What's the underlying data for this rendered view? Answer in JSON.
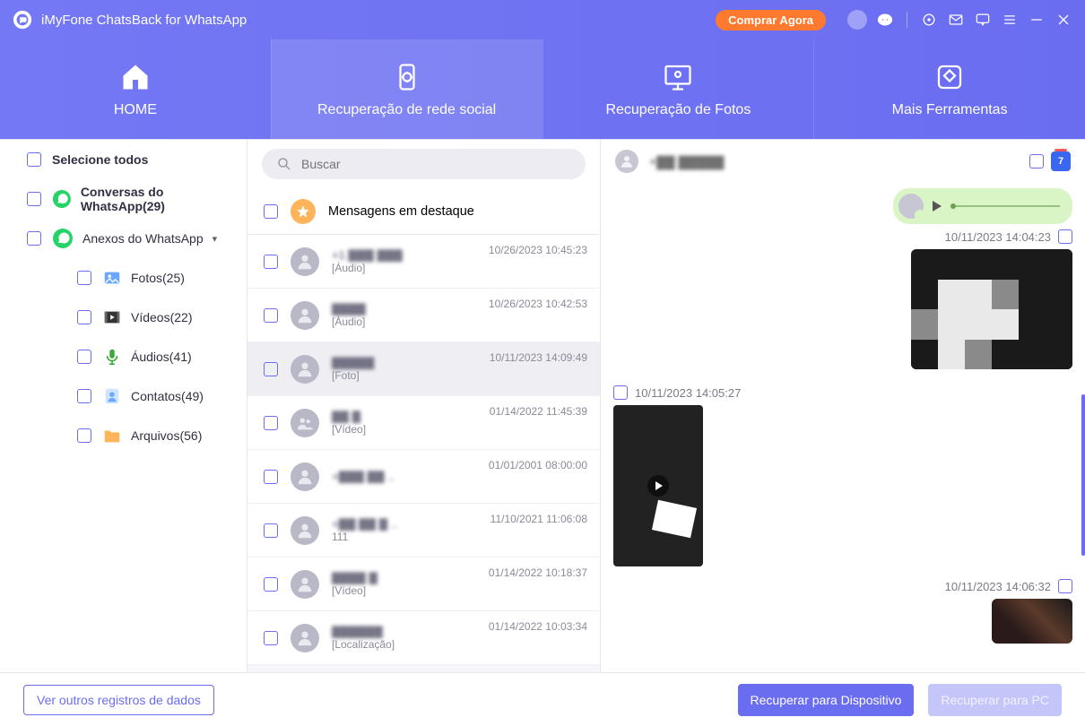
{
  "titlebar": {
    "app_name": "iMyFone ChatsBack for WhatsApp",
    "buy_label": "Comprar Agora"
  },
  "tabs": {
    "home": "HOME",
    "social": "Recuperação de rede social",
    "photos": "Recuperação de Fotos",
    "tools": "Mais Ferramentas"
  },
  "sidebar": {
    "select_all": "Selecione todos",
    "conversations": "Conversas do WhatsApp(29)",
    "attachments": "Anexos do WhatsApp",
    "items": {
      "photos": "Fotos(25)",
      "videos": "Vídeos(22)",
      "audios": "Áudios(41)",
      "contacts": "Contatos(49)",
      "files": "Arquivos(56)"
    }
  },
  "search": {
    "placeholder": "Buscar"
  },
  "starred": {
    "label": "Mensagens em destaque"
  },
  "conversations": [
    {
      "name": "+1 ▓▓▓ ▓▓▓",
      "kind": "[Áudio]",
      "ts": "10/26/2023 10:45:23"
    },
    {
      "name": "▓▓▓▓",
      "kind": "[Áudio]",
      "ts": "10/26/2023 10:42:53"
    },
    {
      "name": "▓▓▓▓▓",
      "kind": "[Foto]",
      "ts": "10/11/2023 14:09:49",
      "selected": true
    },
    {
      "name": "▓▓ ▓",
      "kind": "[Vídeo]",
      "ts": "01/14/2022 11:45:39",
      "group": true
    },
    {
      "name": "+▓▓▓ ▓▓ ..",
      "kind": "",
      "ts": "01/01/2001 08:00:00"
    },
    {
      "name": "+▓▓ ▓▓ ▓ ..",
      "kind": "111",
      "ts": "11/10/2021 11:06:08"
    },
    {
      "name": "▓▓▓▓ ▓",
      "kind": "[Vídeo]",
      "ts": "01/14/2022 10:18:37"
    },
    {
      "name": "▓▓▓▓▓▓",
      "kind": "[Localização]",
      "ts": "01/14/2022 10:03:34"
    }
  ],
  "chat": {
    "contact_name": "+▓▓ ▓▓▓▓▓",
    "calendar_badge": "7",
    "msgs": {
      "ts1": "10/11/2023 14:04:23",
      "ts2": "10/11/2023 14:05:27",
      "ts3": "10/11/2023 14:06:32"
    }
  },
  "footer": {
    "other_records": "Ver outros registros de dados",
    "recover_device": "Recuperar para Dispositivo",
    "recover_pc": "Recuperar para PC"
  }
}
